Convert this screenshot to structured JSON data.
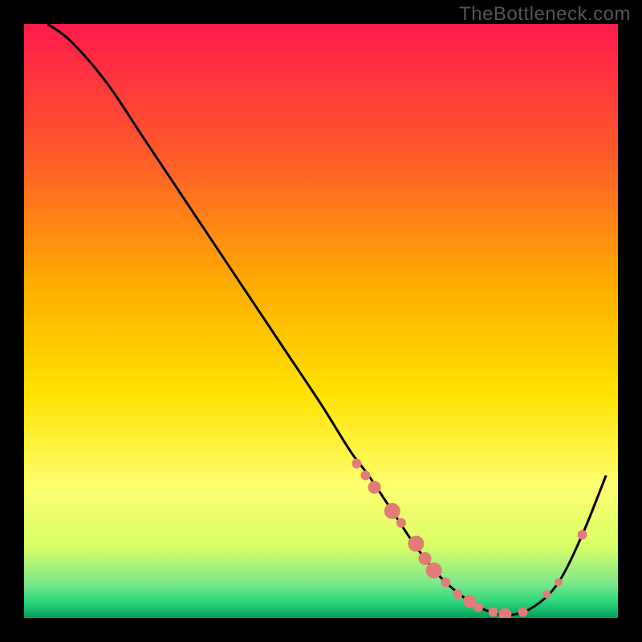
{
  "watermark": "TheBottleneck.com",
  "colors": {
    "frame_bg": "#000000",
    "curve_stroke": "#000000",
    "marker_fill": "#e37b79",
    "gradient_top": "#ff1a4b",
    "gradient_mid_upper": "#ff8a00",
    "gradient_mid": "#ffd200",
    "gradient_mid_lower": "#ffff66",
    "gradient_low": "#d8ff66",
    "gradient_emerald": "#33d97c",
    "gradient_bottom": "#00a05a"
  },
  "chart_data": {
    "type": "line",
    "title": "",
    "xlabel": "",
    "ylabel": "",
    "xlim": [
      0,
      100
    ],
    "ylim": [
      0,
      100
    ],
    "series": [
      {
        "name": "curve",
        "x": [
          4,
          8,
          14,
          20,
          26,
          32,
          38,
          44,
          50,
          55,
          58,
          62,
          66,
          70,
          74,
          78,
          82,
          86,
          90,
          94,
          98
        ],
        "y": [
          100,
          97,
          90,
          81,
          72,
          63,
          54,
          45,
          36,
          28,
          24,
          18,
          12,
          7,
          3.5,
          1.2,
          0.5,
          2,
          6,
          14,
          24
        ]
      }
    ],
    "markers": {
      "name": "dots",
      "points": [
        {
          "x": 56,
          "y": 26,
          "r": 6
        },
        {
          "x": 57.5,
          "y": 24,
          "r": 6
        },
        {
          "x": 59,
          "y": 22,
          "r": 8
        },
        {
          "x": 62,
          "y": 18,
          "r": 10
        },
        {
          "x": 63.5,
          "y": 16,
          "r": 6
        },
        {
          "x": 66,
          "y": 12.5,
          "r": 10
        },
        {
          "x": 67.5,
          "y": 10,
          "r": 8
        },
        {
          "x": 69,
          "y": 8,
          "r": 10
        },
        {
          "x": 71,
          "y": 6,
          "r": 6
        },
        {
          "x": 73,
          "y": 4,
          "r": 6
        },
        {
          "x": 75,
          "y": 2.8,
          "r": 8
        },
        {
          "x": 76.5,
          "y": 1.8,
          "r": 6
        },
        {
          "x": 79,
          "y": 1.0,
          "r": 6
        },
        {
          "x": 81,
          "y": 0.6,
          "r": 8
        },
        {
          "x": 84,
          "y": 1.0,
          "r": 6
        },
        {
          "x": 88,
          "y": 4,
          "r": 5
        },
        {
          "x": 90,
          "y": 6,
          "r": 5
        },
        {
          "x": 94,
          "y": 14,
          "r": 6
        }
      ]
    }
  }
}
